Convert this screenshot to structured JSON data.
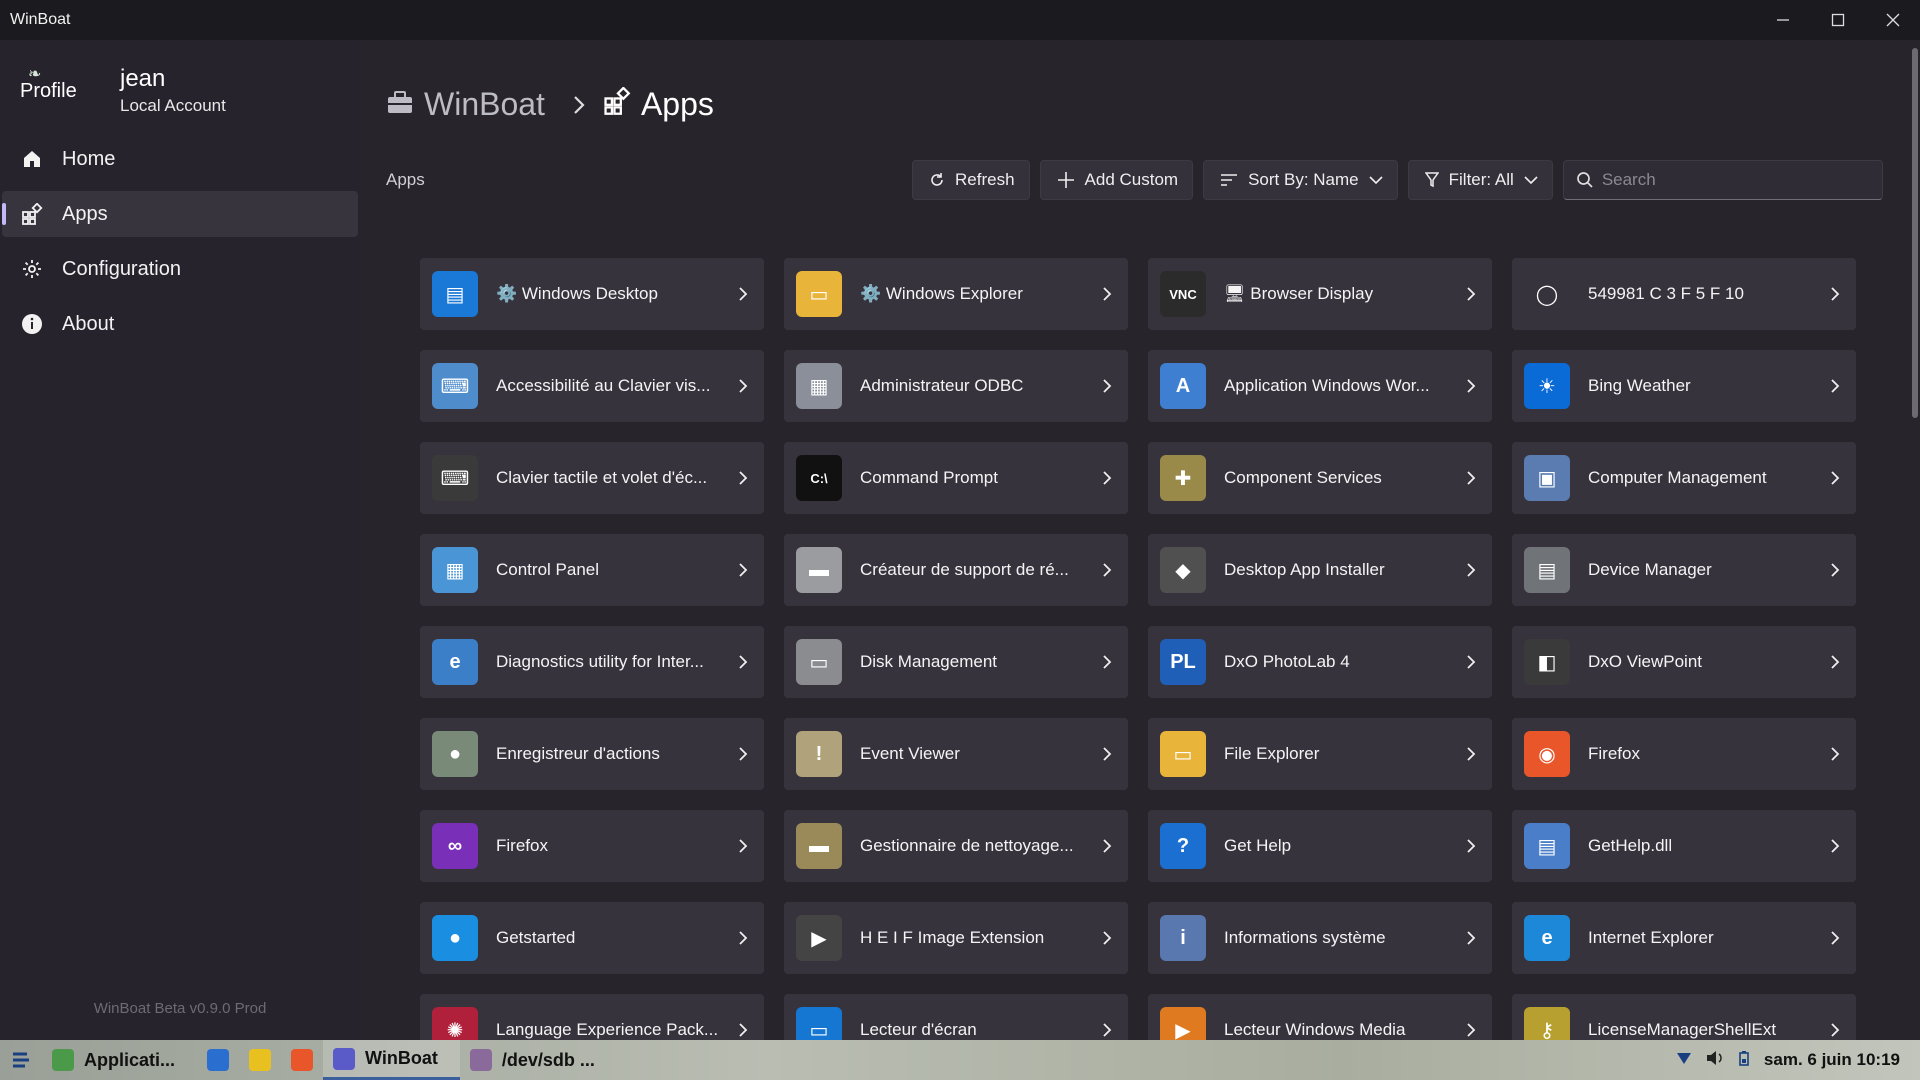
{
  "window": {
    "title": "WinBoat"
  },
  "profile": {
    "image_alt": "Profile",
    "name": "jean",
    "account_type": "Local Account"
  },
  "nav": [
    {
      "label": "Home",
      "icon": "home-icon",
      "active": false
    },
    {
      "label": "Apps",
      "icon": "apps-icon",
      "active": true
    },
    {
      "label": "Configuration",
      "icon": "gear-icon",
      "active": false
    },
    {
      "label": "About",
      "icon": "info-icon",
      "active": false
    }
  ],
  "version": "WinBoat Beta v0.9.0 Prod",
  "breadcrumb": {
    "root": "WinBoat",
    "current": "Apps"
  },
  "section_label": "Apps",
  "toolbar": {
    "refresh": "Refresh",
    "add_custom": "Add Custom",
    "sort": "Sort By: Name",
    "filter": "Filter: All",
    "search_placeholder": "Search"
  },
  "apps": [
    {
      "name": "⚙️ Windows Desktop",
      "icon": "windows-desktop-icon",
      "color": "#1a78d6",
      "glyph": "▤"
    },
    {
      "name": "⚙️ Windows Explorer",
      "icon": "folder-icon",
      "color": "#e8b43a",
      "glyph": "▭"
    },
    {
      "name": "🖥 Browser Display",
      "icon": "novnc-icon",
      "color": "#2b2b2b",
      "glyph": "VNC"
    },
    {
      "name": "549981 C 3 F 5 F 10",
      "icon": "cortana-icon",
      "color": "#37333d",
      "glyph": "◯"
    },
    {
      "name": "Accessibilité au Clavier vis...",
      "icon": "keyboard-screen-icon",
      "color": "#4f8ccc",
      "glyph": "⌨"
    },
    {
      "name": "Administrateur ODBC",
      "icon": "odbc-icon",
      "color": "#8a8f99",
      "glyph": "▦"
    },
    {
      "name": "Application Windows Wor...",
      "icon": "wordpad-icon",
      "color": "#3e7fd1",
      "glyph": "A"
    },
    {
      "name": "Bing Weather",
      "icon": "weather-icon",
      "color": "#0a6ad6",
      "glyph": "☀"
    },
    {
      "name": "Clavier tactile et volet d'éc...",
      "icon": "touch-keyboard-icon",
      "color": "#3a3a3a",
      "glyph": "⌨"
    },
    {
      "name": "Command Prompt",
      "icon": "terminal-icon",
      "color": "#111111",
      "glyph": "C:\\"
    },
    {
      "name": "Component Services",
      "icon": "component-services-icon",
      "color": "#9a8a4a",
      "glyph": "✚"
    },
    {
      "name": "Computer Management",
      "icon": "computer-management-icon",
      "color": "#5a7cb0",
      "glyph": "▣"
    },
    {
      "name": "Control Panel",
      "icon": "control-panel-icon",
      "color": "#4a95d6",
      "glyph": "▦"
    },
    {
      "name": "Créateur de support de ré...",
      "icon": "drive-icon",
      "color": "#9a9ca0",
      "glyph": "▬"
    },
    {
      "name": "Desktop App Installer",
      "icon": "app-installer-icon",
      "color": "#505050",
      "glyph": "◆"
    },
    {
      "name": "Device Manager",
      "icon": "device-manager-icon",
      "color": "#707478",
      "glyph": "▤"
    },
    {
      "name": "Diagnostics utility for Inter...",
      "icon": "ie-diagnostics-icon",
      "color": "#3a7fc8",
      "glyph": "e"
    },
    {
      "name": "Disk Management",
      "icon": "disk-management-icon",
      "color": "#8a8c90",
      "glyph": "▭"
    },
    {
      "name": "DxO PhotoLab 4",
      "icon": "dxo-photolab-icon",
      "color": "#1f5fb8",
      "glyph": "PL"
    },
    {
      "name": "DxO ViewPoint",
      "icon": "dxo-viewpoint-icon",
      "color": "#3a3a3a",
      "glyph": "◧"
    },
    {
      "name": "Enregistreur d'actions",
      "icon": "steps-recorder-icon",
      "color": "#7a8a78",
      "glyph": "●"
    },
    {
      "name": "Event Viewer",
      "icon": "event-viewer-icon",
      "color": "#b0a27a",
      "glyph": "!"
    },
    {
      "name": "File Explorer",
      "icon": "folder-icon",
      "color": "#e8b43a",
      "glyph": "▭"
    },
    {
      "name": "Firefox",
      "icon": "firefox-icon",
      "color": "#e8562a",
      "glyph": "◉"
    },
    {
      "name": "Firefox",
      "icon": "firefox-private-icon",
      "color": "#7a2fb8",
      "glyph": "∞"
    },
    {
      "name": "Gestionnaire de nettoyage...",
      "icon": "disk-cleanup-icon",
      "color": "#9a8a5a",
      "glyph": "▬"
    },
    {
      "name": "Get Help",
      "icon": "get-help-icon",
      "color": "#1b6fd0",
      "glyph": "?"
    },
    {
      "name": "GetHelp.dll",
      "icon": "dll-icon",
      "color": "#4a7ec8",
      "glyph": "▤"
    },
    {
      "name": "Getstarted",
      "icon": "getstarted-icon",
      "color": "#1a8ee0",
      "glyph": "●"
    },
    {
      "name": "H E I F Image Extension",
      "icon": "heif-icon",
      "color": "#444444",
      "glyph": "▶"
    },
    {
      "name": "Informations système",
      "icon": "system-info-icon",
      "color": "#5a78b0",
      "glyph": "i"
    },
    {
      "name": "Internet Explorer",
      "icon": "internet-explorer-icon",
      "color": "#1e88d8",
      "glyph": "e"
    },
    {
      "name": "Language Experience Pack...",
      "icon": "language-pack-icon",
      "color": "#b0203a",
      "glyph": "✺"
    },
    {
      "name": "Lecteur d'écran",
      "icon": "narrator-icon",
      "color": "#1677d2",
      "glyph": "▭"
    },
    {
      "name": "Lecteur Windows Media",
      "icon": "media-player-icon",
      "color": "#e07a20",
      "glyph": "▶"
    },
    {
      "name": "LicenseManagerShellExt",
      "icon": "license-key-icon",
      "color": "#b8a030",
      "glyph": "⚷"
    }
  ],
  "taskbar": {
    "items": [
      {
        "label": "Applicati...",
        "icon": "app-launcher-icon",
        "color": "#4a9a4a",
        "active": false
      },
      {
        "label": "",
        "icon": "browser-icon",
        "color": "#2a6ed0",
        "active": false
      },
      {
        "label": "",
        "icon": "chrome-like-icon",
        "color": "#e8c020",
        "active": false
      },
      {
        "label": "",
        "icon": "firefox-icon",
        "color": "#e8562a",
        "active": false
      },
      {
        "label": "WinBoat",
        "icon": "winboat-icon",
        "color": "#5a5ac8",
        "active": true
      },
      {
        "label": "/dev/sdb ...",
        "icon": "disk-tool-icon",
        "color": "#8a6a9a",
        "active": false
      }
    ],
    "clock": "sam. 6 juin 10:19"
  }
}
